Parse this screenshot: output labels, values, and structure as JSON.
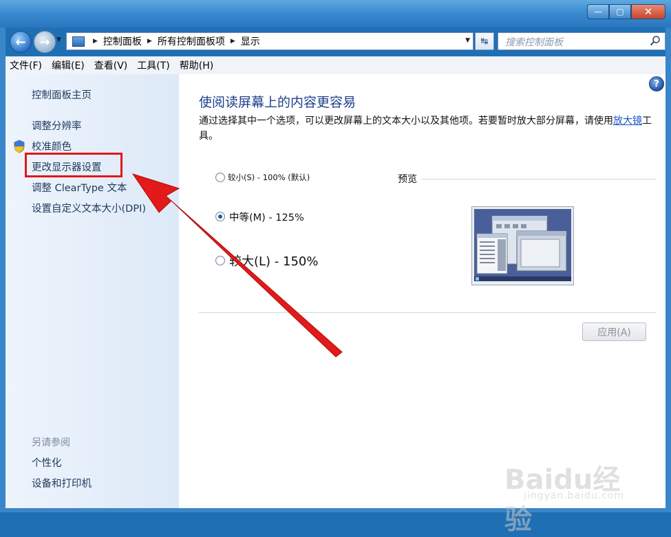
{
  "window": {
    "minimize_label": "—",
    "maximize_label": "▢",
    "close_label": "✕"
  },
  "nav": {
    "breadcrumbs": [
      "控制面板",
      "所有控制面板项",
      "显示"
    ],
    "search_placeholder": "搜索控制面板"
  },
  "menu": [
    "文件(F)",
    "编辑(E)",
    "查看(V)",
    "工具(T)",
    "帮助(H)"
  ],
  "sidebar": {
    "home": "控制面板主页",
    "links": [
      "调整分辨率",
      "校准颜色",
      "更改显示器设置",
      "调整 ClearType 文本",
      "设置自定义文本大小(DPI)"
    ],
    "see_also_title": "另请参阅",
    "see_also": [
      "个性化",
      "设备和打印机"
    ]
  },
  "main": {
    "title": "使阅读屏幕上的内容更容易",
    "desc_before": "通过选择其中一个选项，可以更改屏幕上的文本大小以及其他项。若要暂时放大部分屏幕，请使用",
    "desc_link": "放大镜",
    "desc_after": "工具。",
    "options": [
      {
        "label": "较小(S) - 100% (默认)",
        "checked": false
      },
      {
        "label": "中等(M) - 125%",
        "checked": true
      },
      {
        "label": "较大(L) - 150%",
        "checked": false
      }
    ],
    "preview_label": "预览",
    "apply_label": "应用(A)"
  },
  "watermark": {
    "brand": "Baidu经验",
    "url": "jingyan.baidu.com"
  },
  "colors": {
    "highlight": "#e01818",
    "link": "#1a55c8",
    "title": "#1e3f8a"
  }
}
